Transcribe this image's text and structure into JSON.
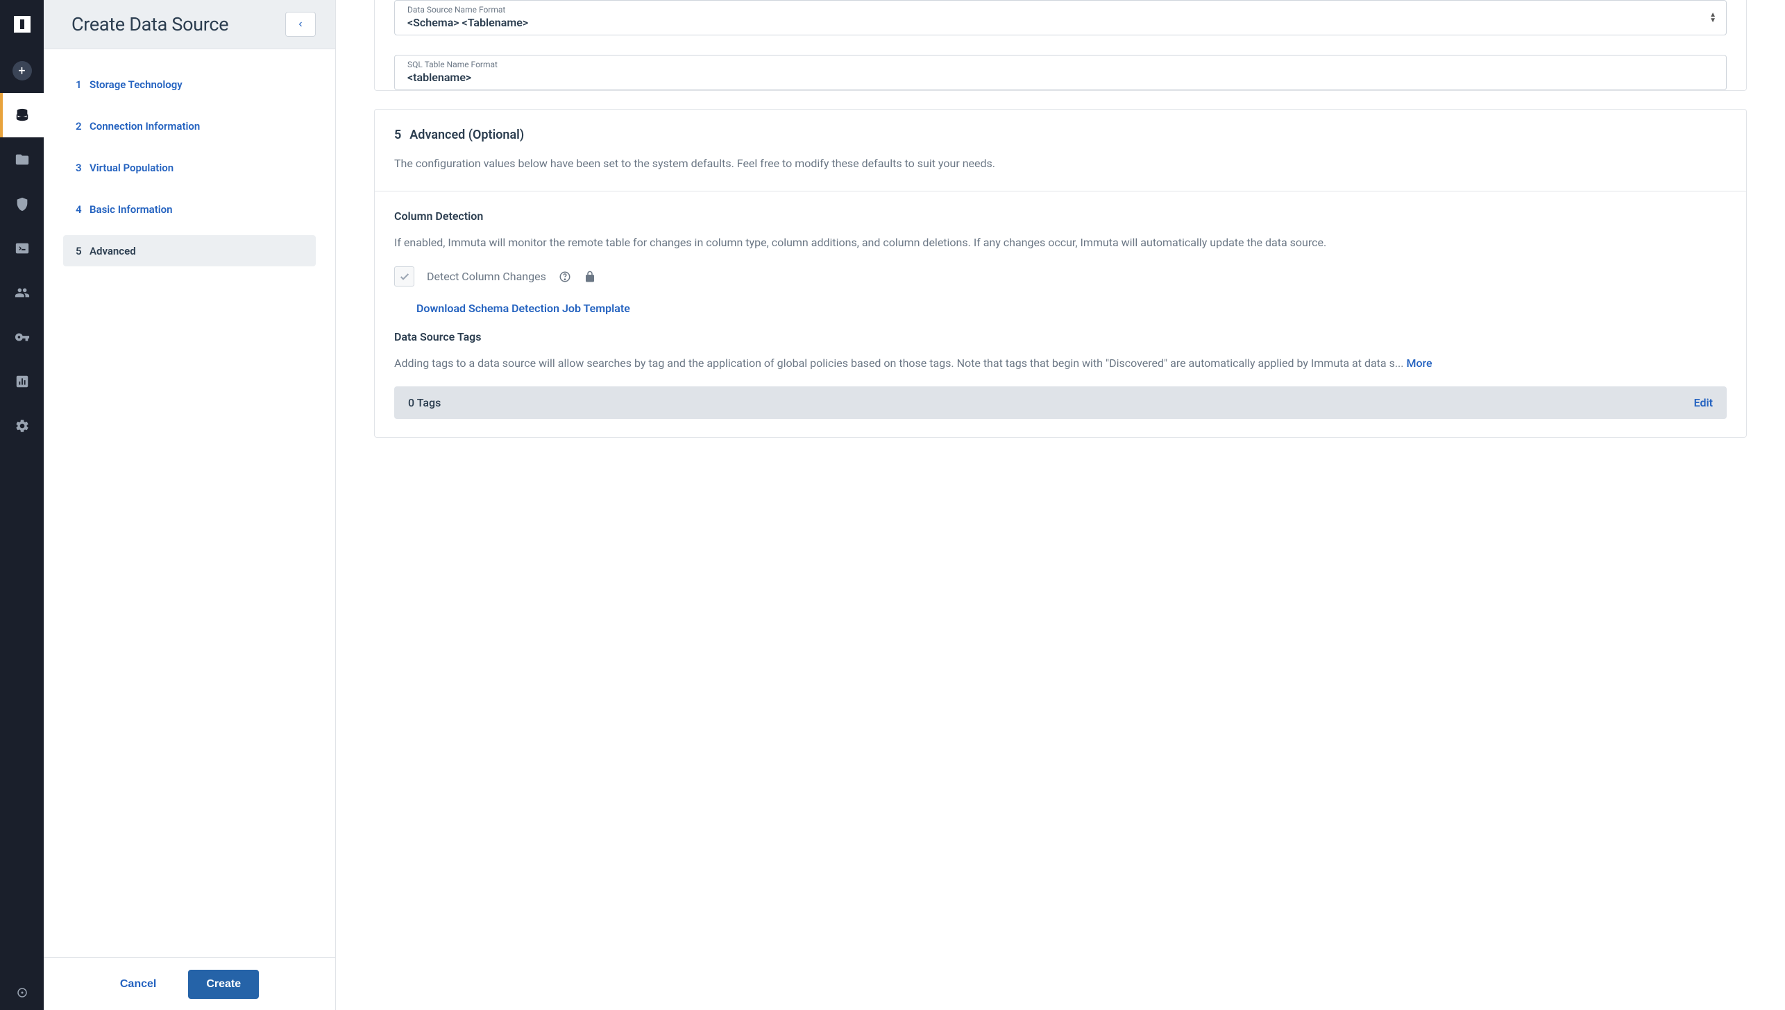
{
  "sidebar": {
    "title": "Create Data Source",
    "steps": [
      {
        "num": "1",
        "label": "Storage Technology"
      },
      {
        "num": "2",
        "label": "Connection Information"
      },
      {
        "num": "3",
        "label": "Virtual Population"
      },
      {
        "num": "4",
        "label": "Basic Information"
      },
      {
        "num": "5",
        "label": "Advanced"
      }
    ],
    "cancel": "Cancel",
    "create": "Create"
  },
  "fields": {
    "dsname_label": "Data Source Name Format",
    "dsname_value": "<Schema> <Tablename>",
    "sqltable_label": "SQL Table Name Format",
    "sqltable_value": "<tablename>"
  },
  "advanced": {
    "num": "5",
    "title": "Advanced (Optional)",
    "desc": "The configuration values below have been set to the system defaults. Feel free to modify these defaults to suit your needs."
  },
  "column_detection": {
    "title": "Column Detection",
    "desc": "If enabled, Immuta will monitor the remote table for changes in column type, column additions, and column deletions. If any changes occur, Immuta will automatically update the data source.",
    "checkbox_label": "Detect Column Changes",
    "download_link": "Download Schema Detection Job Template"
  },
  "tags": {
    "title": "Data Source Tags",
    "desc": "Adding tags to a data source will allow searches by tag and the application of global policies based on those tags. Note that tags that begin with \"Discovered\" are automatically applied by Immuta at data s...  ",
    "more": "More",
    "count": "0 Tags",
    "edit": "Edit"
  }
}
